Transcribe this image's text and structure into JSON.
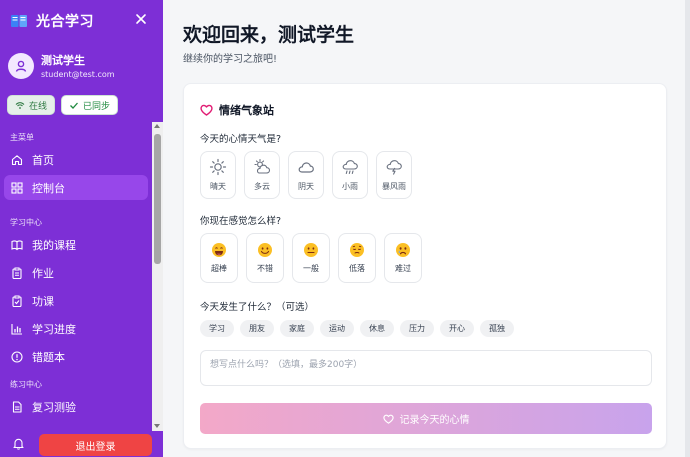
{
  "app": {
    "title": "光合学习"
  },
  "user": {
    "name": "测试学生",
    "email": "student@test.com"
  },
  "status": {
    "online": "在线",
    "synced": "已同步"
  },
  "sidebar": {
    "sections": [
      {
        "label": "主菜单",
        "items": [
          {
            "label": "首页",
            "icon": "home-icon"
          },
          {
            "label": "控制台",
            "icon": "dashboard-icon",
            "active": true
          }
        ]
      },
      {
        "label": "学习中心",
        "items": [
          {
            "label": "我的课程",
            "icon": "book-icon"
          },
          {
            "label": "作业",
            "icon": "clipboard-icon"
          },
          {
            "label": "功课",
            "icon": "clipboard-check-icon"
          },
          {
            "label": "学习进度",
            "icon": "bar-chart-icon"
          },
          {
            "label": "错题本",
            "icon": "alert-circle-icon"
          }
        ]
      },
      {
        "label": "练习中心",
        "items": [
          {
            "label": "复习测验",
            "icon": "document-icon"
          }
        ]
      }
    ],
    "logout": "退出登录"
  },
  "main": {
    "welcome": "欢迎回来，测试学生",
    "subtitle": "继续你的学习之旅吧!"
  },
  "mood_card": {
    "title": "情绪气象站",
    "weather_question": "今天的心情天气是?",
    "weather": [
      "晴天",
      "多云",
      "阴天",
      "小雨",
      "暴风雨"
    ],
    "mood_question": "你现在感觉怎么样?",
    "moods": [
      "超棒",
      "不错",
      "一般",
      "低落",
      "难过"
    ],
    "event_question": "今天发生了什么？（可选）",
    "tags": [
      "学习",
      "朋友",
      "家庭",
      "运动",
      "休息",
      "压力",
      "开心",
      "孤独"
    ],
    "note_placeholder": "想写点什么吗？（选填，最多200字）",
    "submit": "记录今天的心情"
  },
  "colors": {
    "sidebar": "#7d2fd6",
    "active": "#9747ea",
    "logout": "#ef4444",
    "accent": "#e11d74"
  }
}
